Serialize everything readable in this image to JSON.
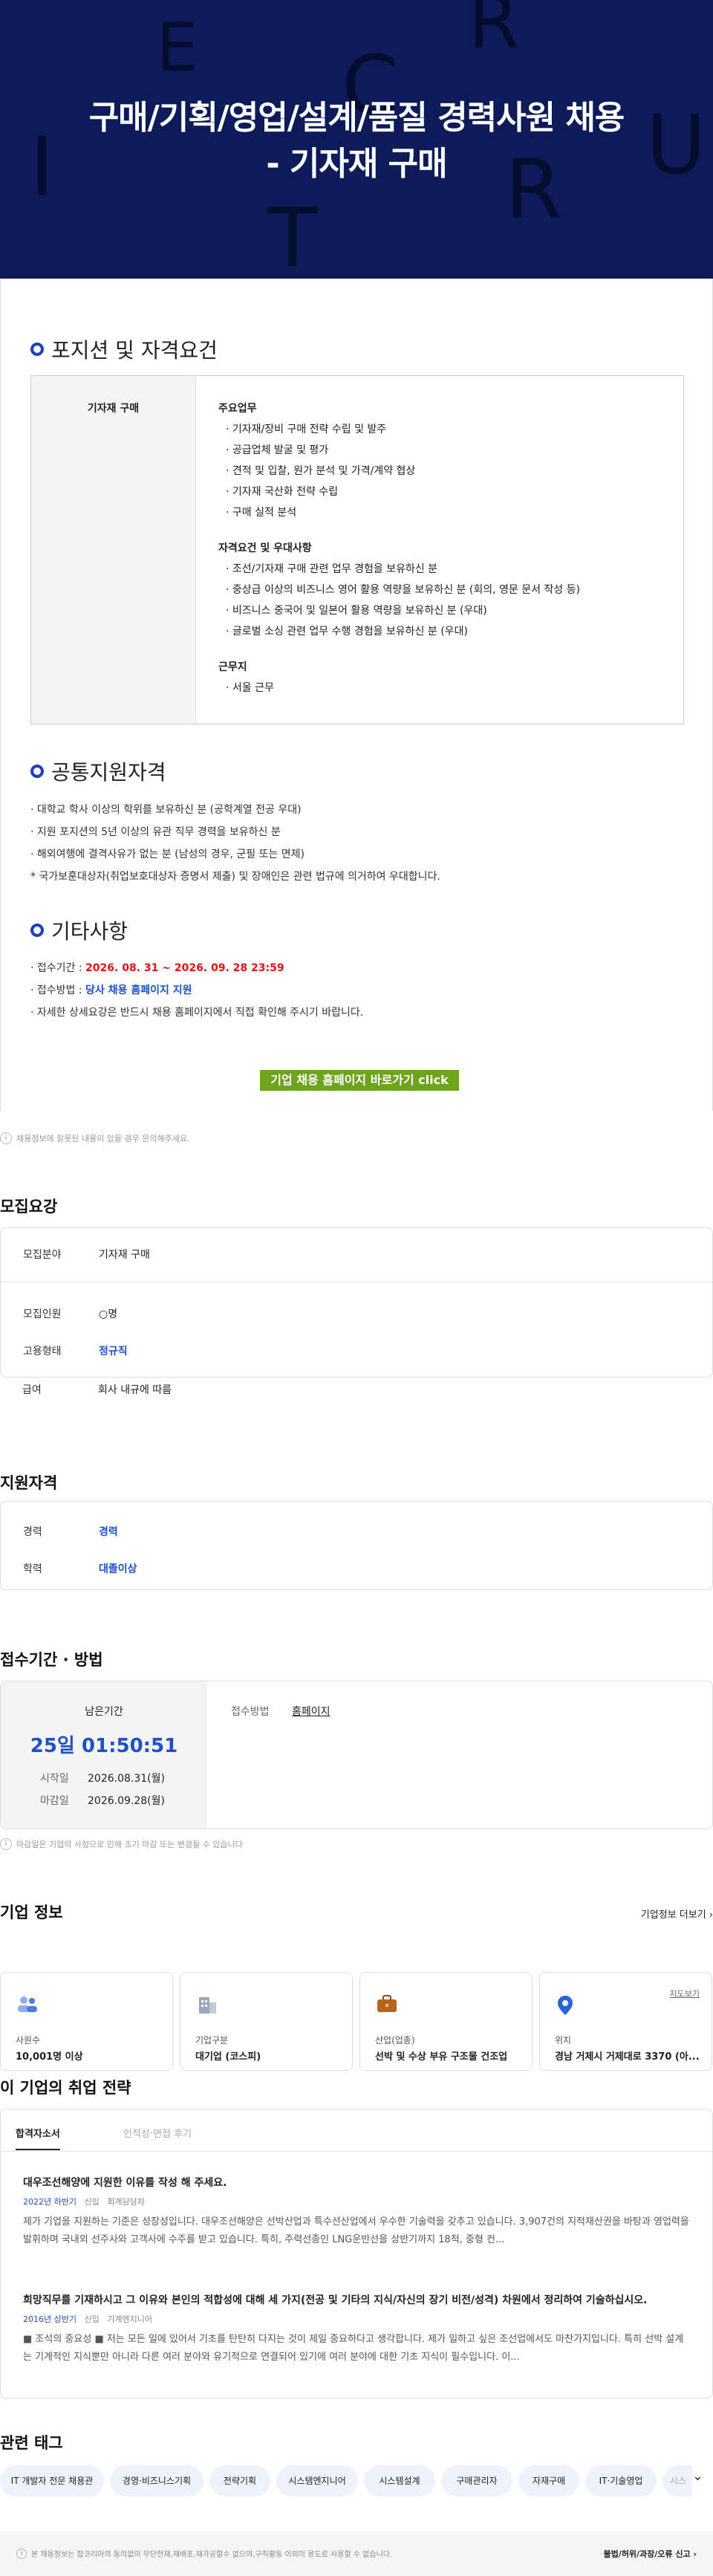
{
  "hero": {
    "deco_letters": [
      "E",
      "R",
      "C",
      "U",
      "I",
      "R",
      "T"
    ],
    "title_line1": "구매/기획/영업/설계/품질 경력사원 채용",
    "title_line2": "- 기자재 구매"
  },
  "positions": {
    "heading": "포지션 및 자격요건",
    "role": "기자재 구매",
    "duties_title": "주요업무",
    "duties": [
      "· 기자재/장비 구매 전략 수립 및 발주",
      "· 공급업체 발굴 및 평가",
      "· 견적 및 입찰, 원가 분석 및 가격/계약 협상",
      "· 기자재 국산화 전략 수립",
      "· 구매 실적 분석"
    ],
    "req_title": "자격요건 및 우대사항",
    "reqs": [
      "· 조선/기자재 구매 관련 업무 경험을 보유하신 분",
      "· 중상급 이상의 비즈니스 영어 활용 역량을 보유하신 분 (회의, 영문 문서 작성 등)",
      "· 비즈니스 중국어 및 일본어 활용 역량을 보유하신 분 (우대)",
      "· 글로벌 소싱 관련 업무 수행 경험을 보유하신 분 (우대)"
    ],
    "place_title": "근무지",
    "places": [
      "· 서울 근무"
    ]
  },
  "common": {
    "heading": "공통지원자격",
    "items": [
      "· 대학교 학사 이상의 학위를 보유하신 분 (공학계열 전공 우대)",
      "· 지원 포지션의 5년 이상의 유관 직무 경력을 보유하신 분",
      "· 해외여행에 결격사유가 없는 분 (남성의 경우, 군필 또는 면제)",
      "* 국가보훈대상자(취업보호대상자 증명서 제출) 및 장애인은 관련 법규에 의거하여 우대합니다."
    ]
  },
  "etc": {
    "heading": "기타사항",
    "period_label": "· 접수기간 : ",
    "period_value": "2026. 08. 31 ~ 2026. 09. 28  23:59",
    "method_label": "· 접수방법 : ",
    "method_value": "당사 채용 홈페이지 지원",
    "detail": "· 자세한 상세요강은 반드시 채용 홈페이지에서 직접 확인해 주시기 바랍니다.",
    "button": "기업 채용 홈페이지 바로가기 click"
  },
  "report_notice": "채용정보에 잘못된 내용이 있을 경우 문의해주세요.",
  "recruit": {
    "title": "모집요강",
    "field_k": "모집분야",
    "field_v": "기자재 구매",
    "people_k": "모집인원",
    "people_v": "○명",
    "type_k": "고용형태",
    "type_v": "정규직",
    "pay_k": "급여",
    "pay_v": "회사 내규에 따름"
  },
  "qual": {
    "title": "지원자격",
    "career_k": "경력",
    "career_v": "경력",
    "edu_k": "학력",
    "edu_v": "대졸이상"
  },
  "apply": {
    "title": "접수기간 · 방법",
    "remaining_label": "남은기간",
    "remaining": "25일 01:50:51",
    "start_k": "시작일",
    "start_v": "2026.08.31(월)",
    "end_k": "마감일",
    "end_v": "2026.09.28(월)",
    "method_k": "접수방법",
    "method_v": "홈페이지",
    "notice": "마감일은 기업의 사정으로 인해 조기 마감 또는 변경될 수 있습니다"
  },
  "company": {
    "title": "기업 정보",
    "more": "기업정보 더보기",
    "map_link": "지도보기",
    "cards": [
      {
        "label": "사원수",
        "value": "10,001명 이상",
        "icon": "people-icon"
      },
      {
        "label": "기업구분",
        "value": "대기업 (코스피)",
        "icon": "building-icon"
      },
      {
        "label": "산업(업종)",
        "value": "선박 및 수상 부유 구조물 건조업",
        "icon": "briefcase-icon"
      },
      {
        "label": "위치",
        "value": "경남 거제시 거제대로 3370 (아...",
        "icon": "location-pin-icon"
      }
    ]
  },
  "strategy": {
    "title": "이 기업의 취업 전략",
    "tab1": "합격자소서",
    "tab2": "인적성·면접 후기",
    "q1": "대우조선해양에 지원한 이유를 작성 해 주세요.",
    "q1_meta": [
      "2022년 하반기",
      "신입",
      "회계담당자"
    ],
    "q1_body": "제가 기업을 지원하는 기준은 성장성입니다. 대우조선해양은 선박산업과 특수선산업에서 우수한 기술력을 갖추고 있습니다. 3,907건의 지적재산권을 바탕과 영업력을 발휘하며 국내외 선주사와 고객사에 수주를 받고 있습니다. 특히, 주력선종인 LNG운반선을 상반기까지 18척, 중형 컨...",
    "q2": "희망직무를 기재하시고 그 이유와 본인의 적합성에 대해 세 가지(전공 및 기타의 지식/자신의 장기 비전/성격) 차원에서 정리하여 기술하십시오.",
    "q2_meta": [
      "2016년 상반기",
      "신입",
      "기계엔지니어"
    ],
    "q2_body": "■ 조석의 중요성 ■ 저는 모든 일에 있어서 기초를 탄탄히 다지는 것이 제일 중요하다고 생각합니다. 제가 일하고 싶은 조선업에서도 마찬가지입니다. 특히 선박 설계는 기계적인 지식뿐만 아니라 다른 여러 분야와 유기적으로 연결되어 있기에 여러 분야에 대한 기초 지식이 필수입니다. 이..."
  },
  "tags": {
    "title": "관련 태그",
    "items": [
      "IT 개발자 전문 채용관",
      "경영·비즈니스기획",
      "전략기획",
      "시스템엔지니어",
      "시스템설계",
      "구매관리자",
      "자재구매",
      "IT·기술영업",
      "시스템"
    ]
  },
  "footer": {
    "text": "본 채용정보는 잡코리아의 동의없이 무단전재,재배포,재가공할수 없으며,구직활동 이외의 용도로 사용할 수 없습니다.",
    "report": "불법/허위/과장/오류 신고"
  }
}
